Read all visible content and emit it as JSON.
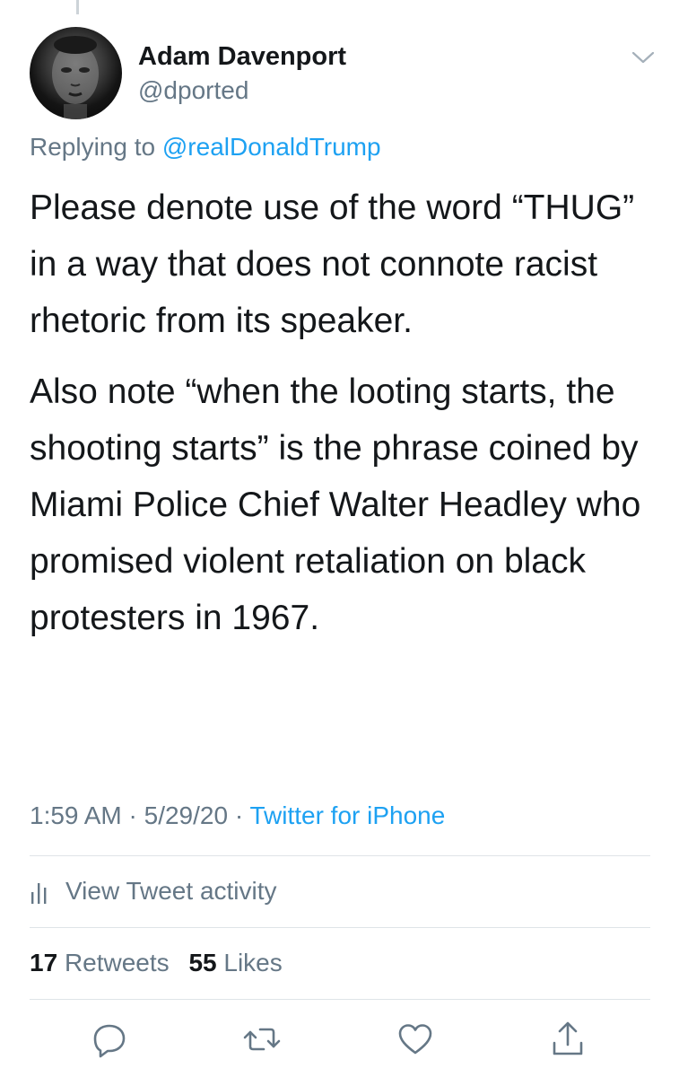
{
  "tweet": {
    "author": {
      "display_name": "Adam Davenport",
      "handle": "@dported"
    },
    "replying_prefix": "Replying to",
    "replying_to": "@realDonaldTrump",
    "paragraphs": [
      "Please denote use of the word “THUG” in a way that does not connote racist rhetoric from its speaker.",
      "Also note “when the looting starts, the shooting starts” is the phrase coined by Miami Police Chief Walter Headley who promised violent retaliation on black protesters in 1967."
    ],
    "time": "1:59 AM",
    "date": "5/29/20",
    "separator": "·",
    "source": "Twitter for iPhone"
  },
  "activity": {
    "label": "View Tweet activity"
  },
  "stats": {
    "retweets_count": "17",
    "retweets_label": "Retweets",
    "likes_count": "55",
    "likes_label": "Likes"
  },
  "actions": [
    "reply-icon",
    "retweet-icon",
    "like-icon",
    "share-icon"
  ],
  "colors": {
    "link": "#1da1f2",
    "secondary_text": "#657786",
    "primary_text": "#14171a",
    "divider": "#dfe4e8"
  }
}
